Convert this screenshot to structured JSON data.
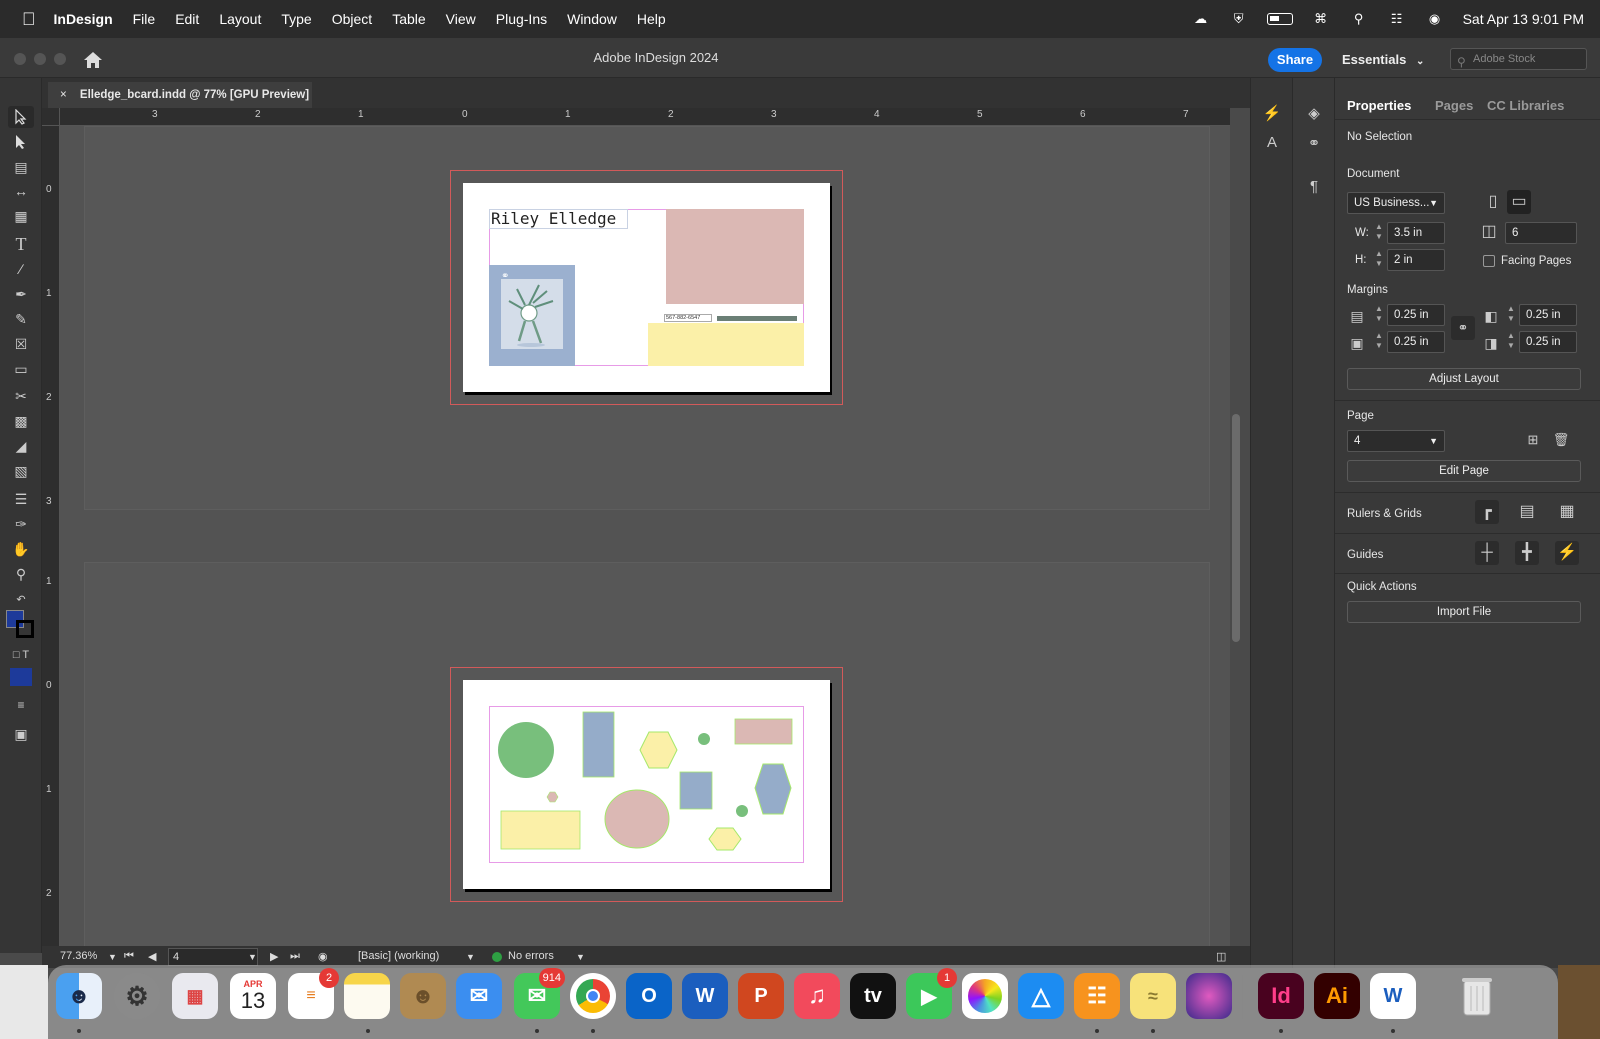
{
  "menubar": {
    "app_name": "InDesign",
    "menus": [
      "File",
      "Edit",
      "Layout",
      "Type",
      "Object",
      "Table",
      "View",
      "Plug-Ins",
      "Window",
      "Help"
    ],
    "datetime": "Sat Apr 13  9:01 PM"
  },
  "window": {
    "title": "Adobe InDesign 2024",
    "share_label": "Share",
    "workspace_label": "Essentials",
    "search_placeholder": "Adobe Stock"
  },
  "document": {
    "tab_label": "Elledge_bcard.indd @ 77% [GPU Preview]",
    "close_glyph": "×"
  },
  "rulers": {
    "top_labels": [
      "3",
      "2",
      "1",
      "0",
      "1",
      "2",
      "3",
      "4",
      "5",
      "6",
      "7"
    ],
    "left_labels_spread1": [
      "0",
      "1",
      "2",
      "3"
    ],
    "left_labels_spread2": [
      "1",
      "0",
      "1",
      "2"
    ]
  },
  "card1": {
    "name_text": "Riley Elledge",
    "phone_text": "567-882-6547",
    "colors": {
      "pink": "#dbb8b4",
      "yellow": "#fbf0a8",
      "blue": "#9bb0cf"
    }
  },
  "card2": {
    "colors": {
      "green": "#78bf7c",
      "blue": "#95acc9",
      "pink": "#dbb8b4",
      "yellow": "#fbf0a8",
      "outline": "#a5e86a"
    }
  },
  "status": {
    "zoom": "77.36%",
    "page": "4",
    "preflight_profile": "[Basic] (working)",
    "errors": "No errors"
  },
  "properties": {
    "tabs": [
      "Properties",
      "Pages",
      "CC Libraries"
    ],
    "selection": "No Selection",
    "document_label": "Document",
    "preset": "US Business...",
    "w_label": "W:",
    "w_value": "3.5 in",
    "h_label": "H:",
    "h_value": "2 in",
    "pages_value": "6",
    "facing_pages_label": "Facing Pages",
    "margins_label": "Margins",
    "margin_top": "0.25 in",
    "margin_bottom": "0.25 in",
    "margin_left": "0.25 in",
    "margin_right": "0.25 in",
    "adjust_layout_label": "Adjust Layout",
    "page_label": "Page",
    "page_value": "4",
    "edit_page_label": "Edit Page",
    "rulers_grids_label": "Rulers & Grids",
    "guides_label": "Guides",
    "quick_actions_label": "Quick Actions",
    "import_file_label": "Import File"
  },
  "dock": {
    "calendar_month": "APR",
    "calendar_day": "13",
    "reminders_badge": "2",
    "messages_badge": "914",
    "facetime_badge": "1",
    "indesign_label": "Id",
    "illustrator_label": "Ai",
    "word_label": "W",
    "outlook_label": "O",
    "powerpoint_label": "P",
    "tv_label": "tv"
  }
}
